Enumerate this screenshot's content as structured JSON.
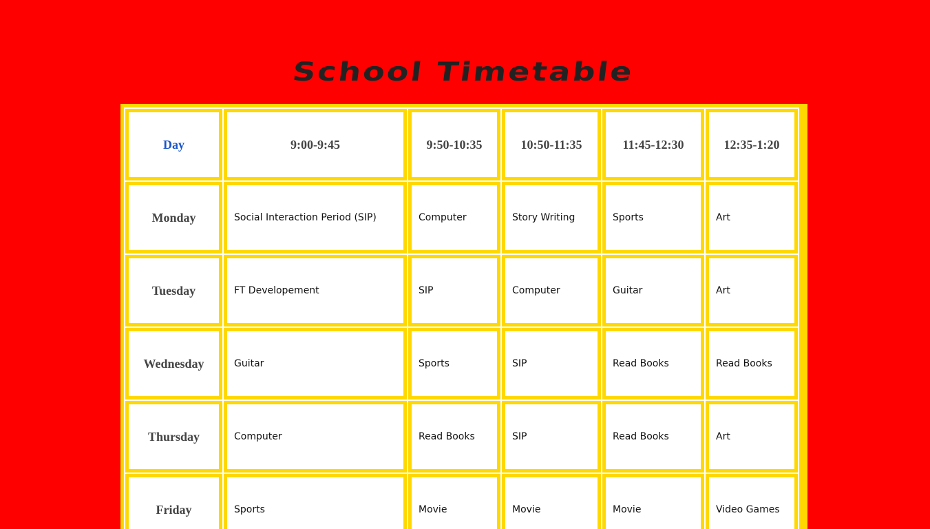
{
  "title": "School Timetable",
  "colors": {
    "background": "#ff0000",
    "border": "#ffd800",
    "day_header": "#1a56c7",
    "header_text": "#444444",
    "title_text": "#222222"
  },
  "timetable": {
    "headers": [
      "Day",
      "9:00-9:45",
      "9:50-10:35",
      "10:50-11:35",
      "11:45-12:30",
      "12:35-1:20"
    ],
    "rows": [
      {
        "day": "Monday",
        "periods": [
          "Social Interaction Period (SIP)",
          "Computer",
          "Story Writing",
          "Sports",
          "Art"
        ]
      },
      {
        "day": "Tuesday",
        "periods": [
          "FT Developement",
          "SIP",
          "Computer",
          "Guitar",
          "Art"
        ]
      },
      {
        "day": "Wednesday",
        "periods": [
          "Guitar",
          "Sports",
          "SIP",
          "Read Books",
          "Read Books"
        ]
      },
      {
        "day": "Thursday",
        "periods": [
          "Computer",
          "Read Books",
          "SIP",
          "Read Books",
          "Art"
        ]
      },
      {
        "day": "Friday",
        "periods": [
          "Sports",
          "Movie",
          "Movie",
          "Movie",
          "Video Games"
        ]
      }
    ]
  }
}
